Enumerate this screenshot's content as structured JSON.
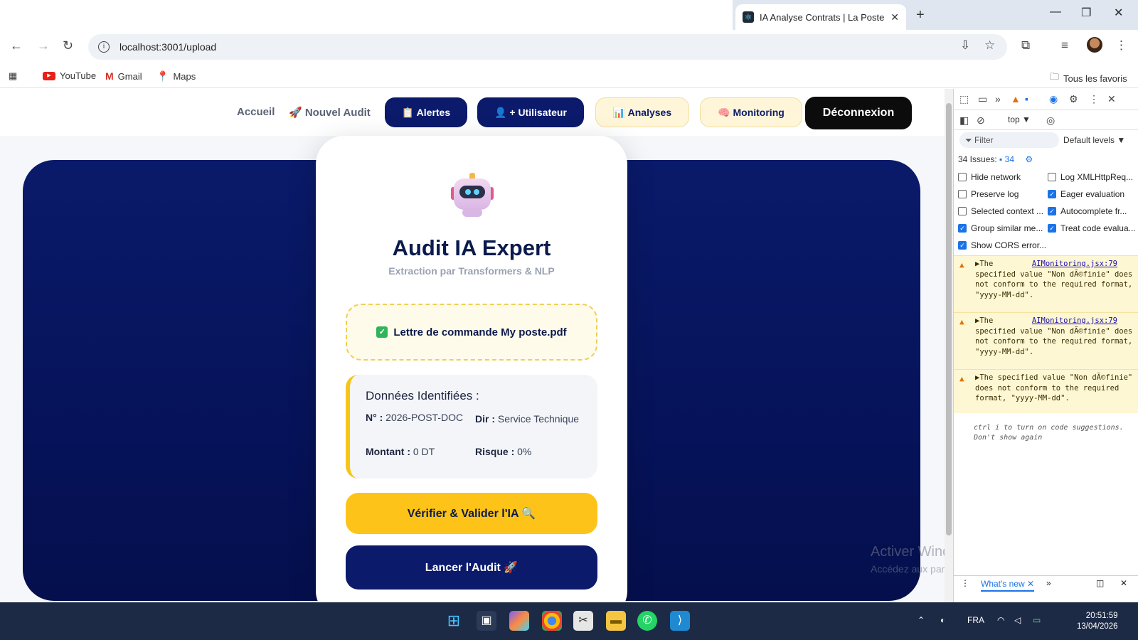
{
  "browser": {
    "tab_title": "IA Analyse Contrats | La Poste",
    "url": "localhost:3001/upload",
    "bookmarks": [
      "YouTube",
      "Gmail",
      "Maps"
    ],
    "all_bookmarks": "Tous les favoris"
  },
  "appnav": {
    "accueil": "Accueil",
    "nouvel_audit": "🚀 Nouvel Audit",
    "alertes": "📋 Alertes",
    "utilisateur": "👤 + Utilisateur",
    "analyses": "📊 Analyses",
    "monitoring": "🧠 Monitoring",
    "deconnexion": "Déconnexion"
  },
  "card": {
    "title": "Audit IA Expert",
    "subtitle": "Extraction par Transformers & NLP",
    "file_name": "Lettre de commande My poste.pdf",
    "data_heading": "Données Identifiées :",
    "fields": {
      "num_label": "N° :",
      "num_value": "2026-POST-DOC",
      "dir_label": "Dir :",
      "dir_value": "Service Technique",
      "montant_label": "Montant :",
      "montant_value": "0 DT",
      "risque_label": "Risque :",
      "risque_value": "0%"
    },
    "verify_button": "Vérifier & Valider l'IA 🔍",
    "launch_button": "Lancer l'Audit 🚀"
  },
  "watermark": {
    "line1": "Activer Windows",
    "line2": "Accédez aux paramètres pour activer Windows."
  },
  "devtools": {
    "context": "top ▼",
    "filter_placeholder": "Filter",
    "levels": "Default levels ▼",
    "issues_label": "34 Issues:",
    "issues_count": "34",
    "options": [
      {
        "label": "Hide network",
        "checked": false
      },
      {
        "label": "Log XMLHttpReq...",
        "checked": false
      },
      {
        "label": "Preserve log",
        "checked": false
      },
      {
        "label": "Eager evaluation",
        "checked": true
      },
      {
        "label": "Selected context ...",
        "checked": false
      },
      {
        "label": "Autocomplete fr...",
        "checked": true
      },
      {
        "label": "Group similar me...",
        "checked": true
      },
      {
        "label": "Treat code evalua...",
        "checked": true
      },
      {
        "label": "Show CORS error...",
        "checked": true
      }
    ],
    "warnings": [
      {
        "link": "AIMonitoring.jsx:79",
        "text": "▶The specified value \"Non dÃ©finie\" does not conform to the required format, \"yyyy-MM-dd\"."
      },
      {
        "link": "AIMonitoring.jsx:79",
        "text": "▶The specified value \"Non dÃ©finie\" does not conform to the required format, \"yyyy-MM-dd\"."
      },
      {
        "link": "",
        "text": "▶The specified value \"Non dÃ©finie\" does not conform to the required format, \"yyyy-MM-dd\"."
      }
    ],
    "hint": "ctrl i to turn on code suggestions. Don't show again",
    "whats_new": "What's new"
  },
  "taskbar": {
    "lang": "FRA",
    "time": "20:51:59",
    "date": "13/04/2026"
  },
  "colors": {
    "navy": "#0b1a6b",
    "yellow": "#fdc318",
    "hero": "#06135a"
  }
}
